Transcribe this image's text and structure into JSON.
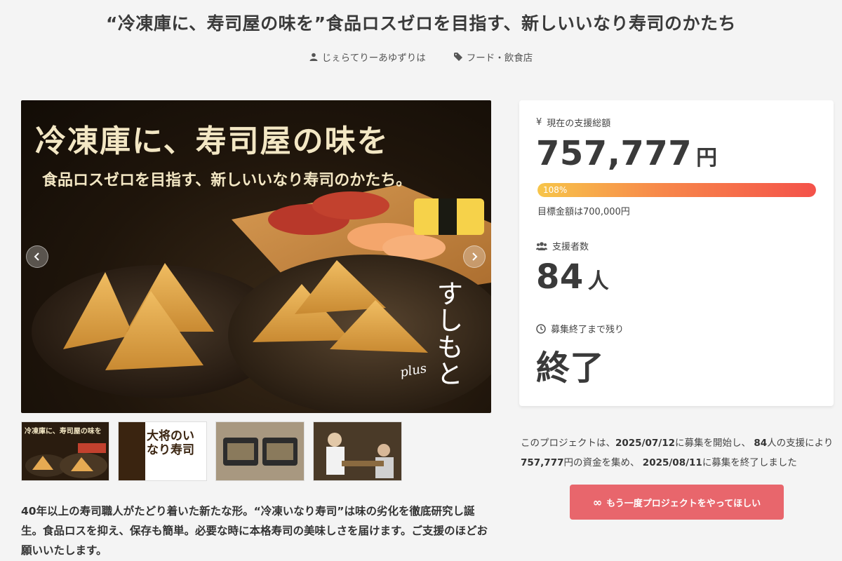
{
  "project": {
    "title": "“冷凍庫に、寿司屋の味を”食品ロスゼロを目指す、新しいいなり寿司のかたち",
    "author": "じぇらてりーあゆずりは",
    "category": "フード・飲食店"
  },
  "hero": {
    "headline": "冷凍庫に、寿司屋の味を",
    "subheadline": "食品ロスゼロを目指す、新しいいなり寿司のかたち。",
    "brand_text": "すしもと",
    "brand_sub": "plus"
  },
  "thumbnails": [
    {
      "caption": "冷凍庫に、寿司屋の味を"
    },
    {
      "caption": "大将のいなり寿司"
    },
    {
      "caption": ""
    },
    {
      "caption": ""
    }
  ],
  "description": "40年以上の寿司職人がたどり着いた新たな形。“冷凍いなり寿司”は味の劣化を徹底研究し誕生。食品ロスを抑え、保存も簡単。必要な時に本格寿司の美味しさを届けます。ご支援のほどお願いいたします。",
  "stats": {
    "amount_label": "現在の支援総額",
    "amount": "757,777",
    "amount_unit": "円",
    "progress_label": "108%",
    "progress_fraction": 1.0,
    "goal_text": "目標金額は700,000円",
    "supporters_label": "支援者数",
    "supporters": "84",
    "supporters_unit": "人",
    "remaining_label": "募集終了まで残り",
    "remaining": "終了"
  },
  "summary": {
    "p1": "このプロジェクトは、",
    "start": "2025/07/12",
    "p2": "に募集を開始し、",
    "count": "84",
    "p3": "人の支援により",
    "amount": "757,777",
    "p4": "円の資金を集め、",
    "end": "2025/08/11",
    "p5": "に募集を終了しました"
  },
  "cta_label": "もう一度プロジェクトをやってほしい",
  "colors": {
    "accent": "#e8666c",
    "progress_start": "#f7c54a",
    "progress_end": "#f4524a"
  }
}
